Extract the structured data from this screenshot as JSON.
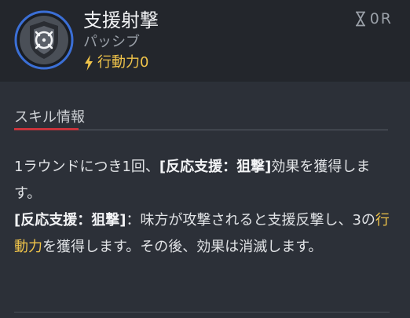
{
  "skill": {
    "name": "支援射撃",
    "type": "パッシブ",
    "action_power_label": "行動力0",
    "cooldown": "0R"
  },
  "section": {
    "title": "スキル情報"
  },
  "description": {
    "p1_text": "1ラウンドにつき1回、",
    "p1_bold": "[反応支援：狙撃]",
    "p1_end": "効果を獲得します。",
    "p2_bold": "[反応支援：狙撃]",
    "p2_text": "：味方が攻撃されると支援反撃し、3の",
    "p2_highlight": "行動力",
    "p2_end": "を獲得します。その後、効果は消滅します。"
  },
  "colors": {
    "background": "#2c3038",
    "header_background": "#23262c",
    "accent_gold": "#f0c44a",
    "accent_red": "#c8343c",
    "icon_ring_blue": "#3b6fd6"
  },
  "icons": {
    "skill": "crosshair-shield-icon",
    "action_power": "lightning-bolt-icon",
    "cooldown": "hourglass-icon"
  }
}
